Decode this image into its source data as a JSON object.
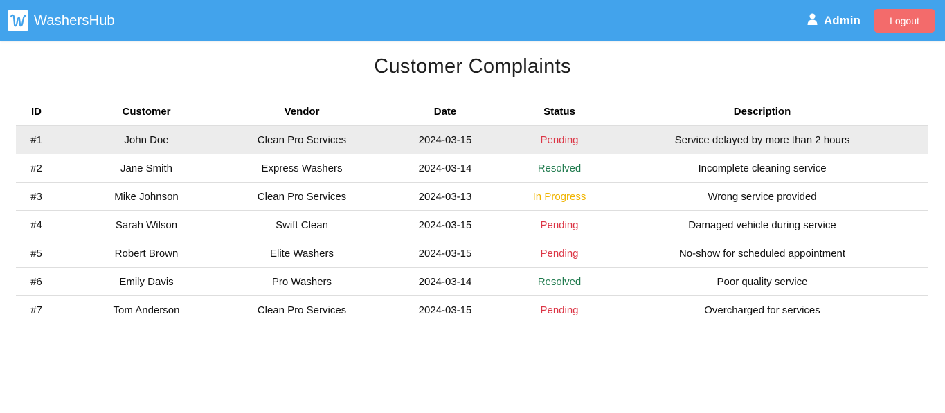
{
  "header": {
    "brand_logo_letter": "W",
    "brand_name": "WashersHub",
    "user_label": "Admin",
    "logout_label": "Logout",
    "colors": {
      "navbar": "#42a3ec",
      "logout": "#f36b6b"
    }
  },
  "page": {
    "title": "Customer Complaints"
  },
  "table": {
    "columns": [
      "ID",
      "Customer",
      "Vendor",
      "Date",
      "Status",
      "Description"
    ],
    "rows": [
      {
        "id": "#1",
        "customer": "John Doe",
        "vendor": "Clean Pro Services",
        "date": "2024-03-15",
        "status": "Pending",
        "description": "Service delayed by more than 2 hours"
      },
      {
        "id": "#2",
        "customer": "Jane Smith",
        "vendor": "Express Washers",
        "date": "2024-03-14",
        "status": "Resolved",
        "description": "Incomplete cleaning service"
      },
      {
        "id": "#3",
        "customer": "Mike Johnson",
        "vendor": "Clean Pro Services",
        "date": "2024-03-13",
        "status": "In Progress",
        "description": "Wrong service provided"
      },
      {
        "id": "#4",
        "customer": "Sarah Wilson",
        "vendor": "Swift Clean",
        "date": "2024-03-15",
        "status": "Pending",
        "description": "Damaged vehicle during service"
      },
      {
        "id": "#5",
        "customer": "Robert Brown",
        "vendor": "Elite Washers",
        "date": "2024-03-15",
        "status": "Pending",
        "description": "No-show for scheduled appointment"
      },
      {
        "id": "#6",
        "customer": "Emily Davis",
        "vendor": "Pro Washers",
        "date": "2024-03-14",
        "status": "Resolved",
        "description": "Poor quality service"
      },
      {
        "id": "#7",
        "customer": "Tom Anderson",
        "vendor": "Clean Pro Services",
        "date": "2024-03-15",
        "status": "Pending",
        "description": "Overcharged for services"
      }
    ],
    "status_colors": {
      "Pending": "#dc3545",
      "Resolved": "#1f7a4d",
      "In Progress": "#f0b400"
    }
  }
}
